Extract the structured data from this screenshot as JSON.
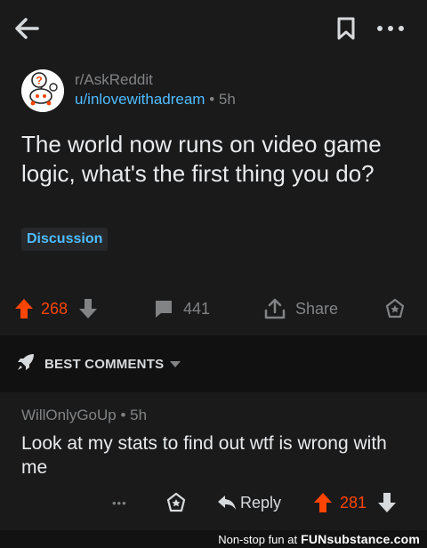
{
  "post": {
    "subreddit": "r/AskReddit",
    "author": "u/inlovewithadream",
    "age": "5h",
    "dot": "•",
    "title": "The world now runs on video game logic, what's the first thing you do?",
    "flair": "Discussion",
    "score": "268",
    "comments": "441",
    "share_label": "Share"
  },
  "sort": {
    "label": "BEST COMMENTS"
  },
  "comment": {
    "author": "WillOnlyGoUp",
    "age": "5h",
    "body": "Look at my stats to find out wtf is wrong with me",
    "reply_label": "Reply",
    "score": "281",
    "more": "•••"
  },
  "footer": {
    "tagline": "Non-stop fun at",
    "brand": "FUNsubstance.com"
  },
  "colors": {
    "background": "#1a1a1b",
    "upvote": "#ff4500",
    "link": "#4fbcff",
    "muted": "#818384"
  }
}
